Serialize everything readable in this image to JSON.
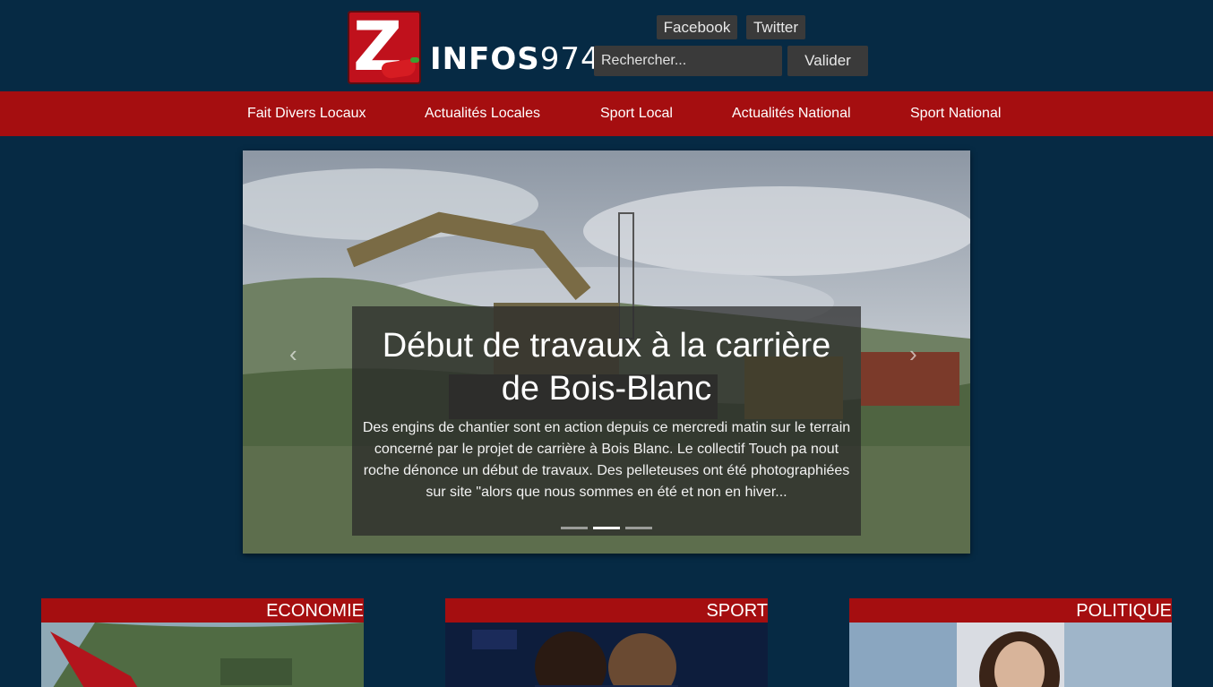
{
  "header": {
    "logo_letter": "Z",
    "logo_bold": "INFOS",
    "logo_num": "974",
    "facebook": "Facebook",
    "twitter": "Twitter",
    "search_placeholder": "Rechercher...",
    "search_button": "Valider"
  },
  "nav": [
    "Fait Divers Locaux",
    "Actualités Locales",
    "Sport Local",
    "Actualités National",
    "Sport National"
  ],
  "carousel": {
    "title": "Début de travaux à la carrière de Bois-Blanc",
    "text": "Des engins de chantier sont en action depuis ce mercredi matin sur le terrain concerné par le projet de carrière à Bois Blanc. Le collectif Touch pa nout roche dénonce un début de travaux. Des pelleteuses ont été photographiées sur site \"alors que nous sommes en été et non en hiver...",
    "prev": "‹",
    "next": "›",
    "slides": 3,
    "active_slide": 2
  },
  "categories": [
    "ECONOMIE",
    "SPORT",
    "POLITIQUE"
  ],
  "colors": {
    "background": "#062a44",
    "nav": "#a50e10",
    "button": "#3a3a3a"
  }
}
